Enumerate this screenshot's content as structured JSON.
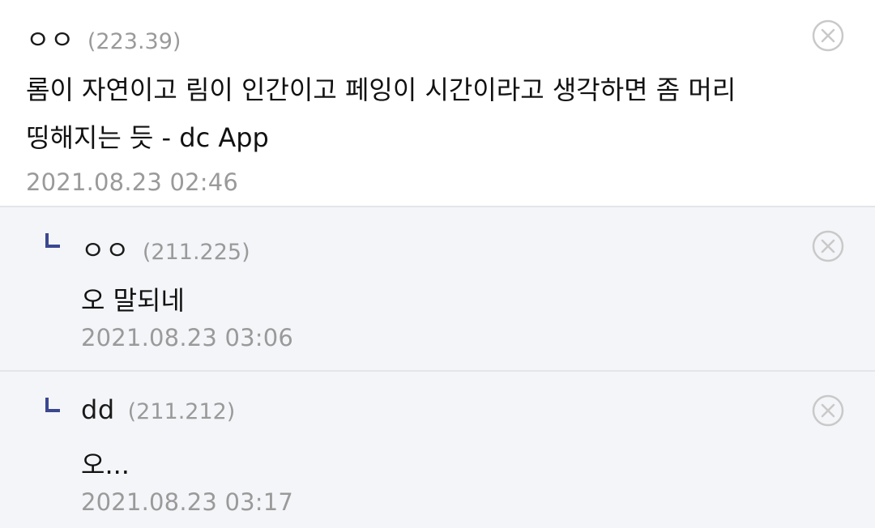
{
  "comments": [
    {
      "nickname": "ㅇㅇ",
      "ip": "(223.39)",
      "text": "롬이 자연이고 림이 인간이고 페잉이 시간이라고 생각하면 좀 머리 띵해지는 듯 - dc App",
      "timestamp": "2021.08.23 02:46"
    },
    {
      "nickname": "ㅇㅇ",
      "ip": "(211.225)",
      "text": "오 말되네",
      "timestamp": "2021.08.23 03:06"
    },
    {
      "nickname": "dd",
      "ip": "(211.212)",
      "text": "오...",
      "timestamp": "2021.08.23 03:17"
    }
  ],
  "icons": {
    "delete": "close-circle-icon",
    "reply": "reply-arrow-icon"
  },
  "colors": {
    "reply_background": "#f4f5f8",
    "reply_mark": "#3b4890",
    "muted_text": "#9a9a9a",
    "divider": "#e3e5ea"
  }
}
